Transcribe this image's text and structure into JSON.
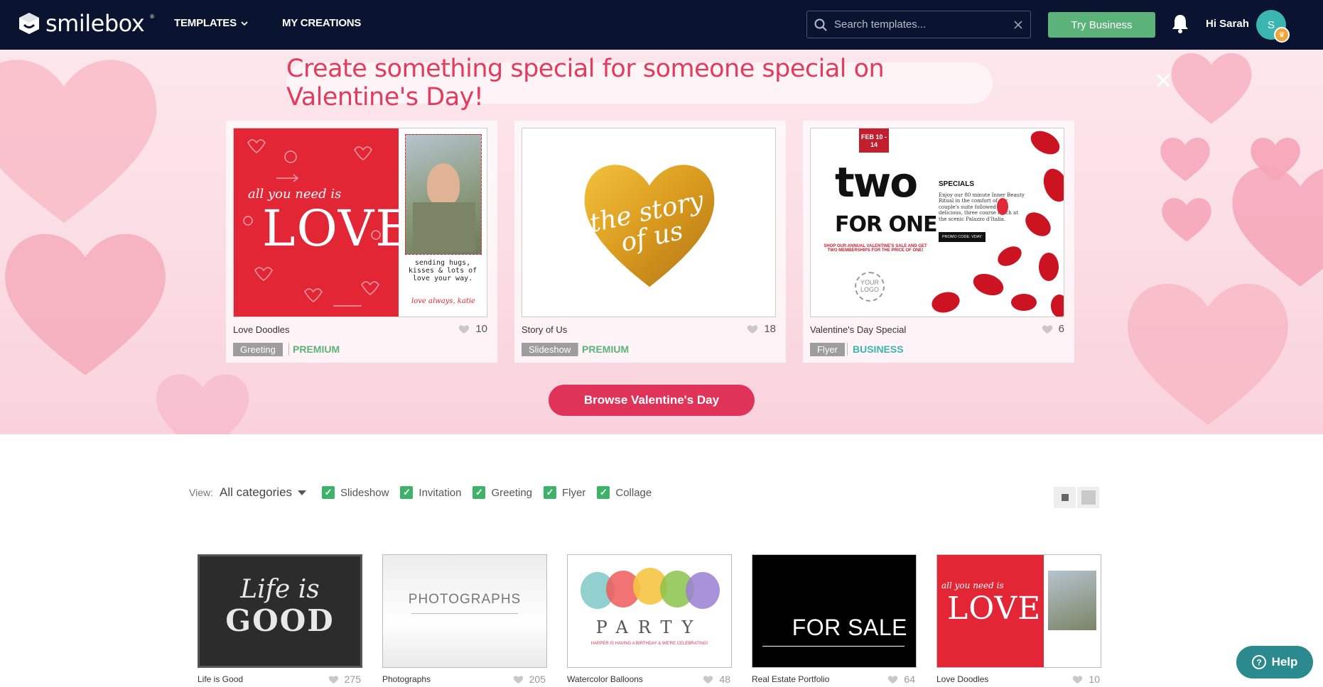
{
  "nav": {
    "logo": "smilebox",
    "logo_reg": "®",
    "templates_label": "TEMPLATES",
    "my_creations_label": "MY CREATIONS",
    "search_placeholder": "Search templates...",
    "try_business_label": "Try Business",
    "greeting": "Hi Sarah",
    "avatar_initial": "S"
  },
  "hero": {
    "title": "Create something special for someone special on Valentine's Day!",
    "close_glyph": "✕",
    "browse_label": "Browse Valentine's Day",
    "cards": [
      {
        "title": "Love Doodles",
        "likes": "10",
        "category": "Greeting",
        "tier": "PREMIUM",
        "tier_color": "#5cb37a",
        "thumb_text": {
          "line1": "all you need is",
          "big": "LOVE",
          "msg": "sending hugs, kisses & lots of love your way.",
          "sig": "love always, katie"
        }
      },
      {
        "title": "Story of Us",
        "likes": "18",
        "category": "Slideshow",
        "tier": "PREMIUM",
        "tier_color": "#5cb37a",
        "thumb_text": {
          "script": "the story of us"
        }
      },
      {
        "title": "Valentine's Day Special",
        "likes": "6",
        "category": "Flyer",
        "tier": "BUSINESS",
        "tier_color": "#3bb5b0",
        "thumb_text": {
          "date": "FEB 10 - 14",
          "two": "two",
          "for_one": "FOR ONE",
          "sale": "SHOP OUR ANNUAL VALENTINE'S SALE AND GET TWO MEMBERSHIPS FOR THE PRICE OF ONE!",
          "logo": "YOUR LOGO",
          "specials": "SPECIALS",
          "specials_body": "Enjoy our 80 minute Inner Beauty Ritual in the comfort of our couple's suite followed by a delicious, three course lunch at the scenic Palazzo d'Italia.",
          "promo": "PROMO CODE: VDAY"
        }
      }
    ]
  },
  "filter": {
    "view_label": "View:",
    "selected": "All categories",
    "options": [
      "Slideshow",
      "Invitation",
      "Greeting",
      "Flyer",
      "Collage"
    ]
  },
  "grid": [
    {
      "title": "Life is Good",
      "likes": "275",
      "art": [
        "Life is",
        "GOOD"
      ]
    },
    {
      "title": "Photographs",
      "likes": "205",
      "art": [
        "PHOTOGRAPHS"
      ]
    },
    {
      "title": "Watercolor Balloons",
      "likes": "48",
      "art": [
        "PARTY",
        "HARPER IS HAVING A BIRTHDAY & WE'RE CELEBRATING!"
      ]
    },
    {
      "title": "Real Estate Portfolio",
      "likes": "64",
      "art": [
        "FOR SALE"
      ]
    },
    {
      "title": "Love Doodles",
      "likes": "10",
      "art": [
        "all you need is",
        "LOVE"
      ]
    }
  ],
  "help_label": "Help",
  "colors": {
    "nav_bg": "#0a1430",
    "accent_pink": "#e0335a",
    "green": "#5cb37a",
    "teal": "#3bb5b0"
  }
}
